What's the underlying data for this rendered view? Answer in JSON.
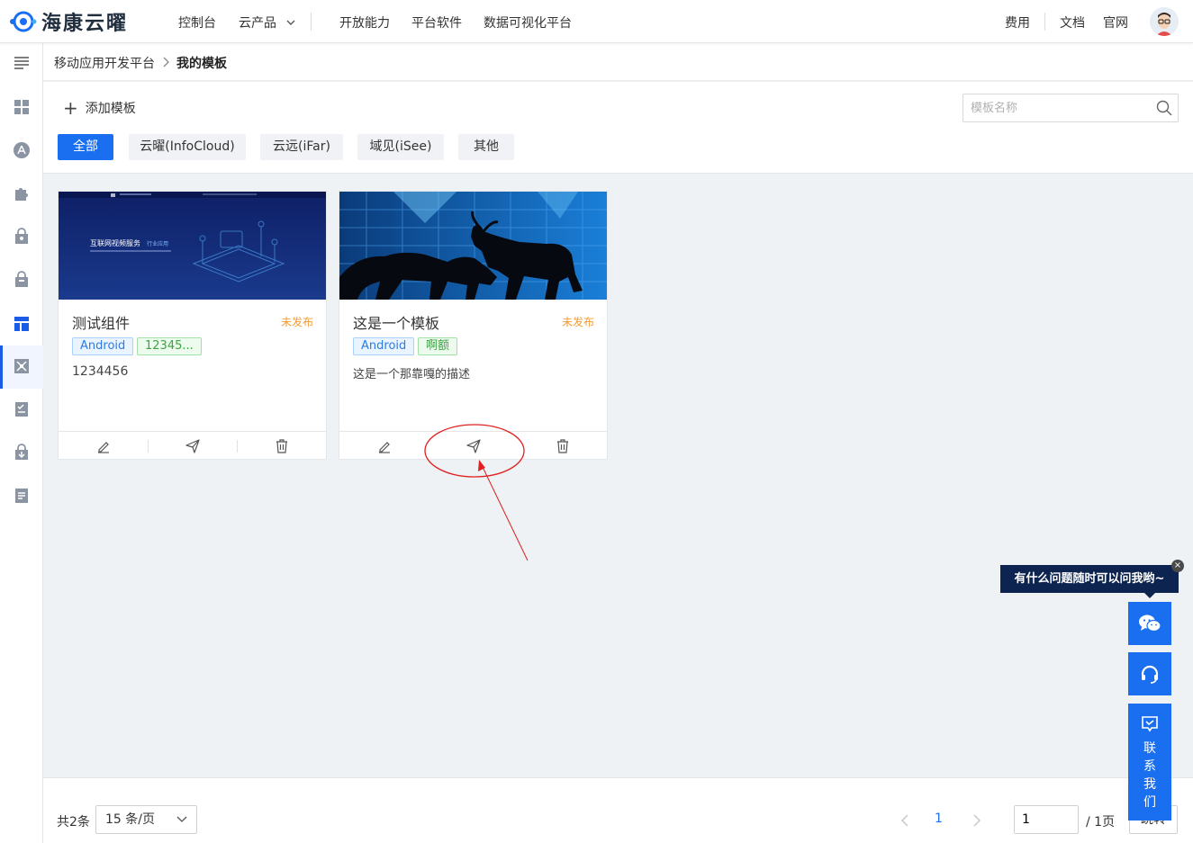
{
  "brand": {
    "name": "海康云曜"
  },
  "topnav": {
    "left": [
      "控制台",
      "云产品",
      "开放能力",
      "平台软件",
      "数据可视化平台"
    ],
    "right": [
      "费用",
      "文档",
      "官网"
    ]
  },
  "breadcrumb": {
    "parent": "移动应用开发平台",
    "current": "我的模板"
  },
  "toolbar": {
    "add_label": "添加模板",
    "search_placeholder": "模板名称"
  },
  "filters": [
    {
      "label": "全部",
      "active": true
    },
    {
      "label": "云曜(InfoCloud)",
      "active": false
    },
    {
      "label": "云远(iFar)",
      "active": false
    },
    {
      "label": "域见(iSee)",
      "active": false
    },
    {
      "label": "其他",
      "active": false
    }
  ],
  "cards": [
    {
      "title": "测试组件",
      "status": "未发布",
      "tags": [
        "Android",
        "12345..."
      ],
      "description": "1234456",
      "thumb": {
        "headline": "互联网视频服务",
        "subline": "行业应用"
      }
    },
    {
      "title": "这是一个模板",
      "status": "未发布",
      "tags": [
        "Android",
        "啊额"
      ],
      "description": "这是一个那靠嘎的描述"
    }
  ],
  "pagination": {
    "total": "共2条",
    "page_size": "15 条/页",
    "current_page": "1",
    "goto_value": "1",
    "of_pages": "/ 1页",
    "jump_label": "跳转"
  },
  "support": {
    "tip": "有什么问题随时可以问我哟~",
    "contact_label": [
      "联",
      "系",
      "我",
      "们"
    ]
  },
  "colors": {
    "primary": "#1a6ff0",
    "status_unpublished": "#f39c35",
    "tip_bg": "#0d2450",
    "annotation": "#e02020"
  }
}
